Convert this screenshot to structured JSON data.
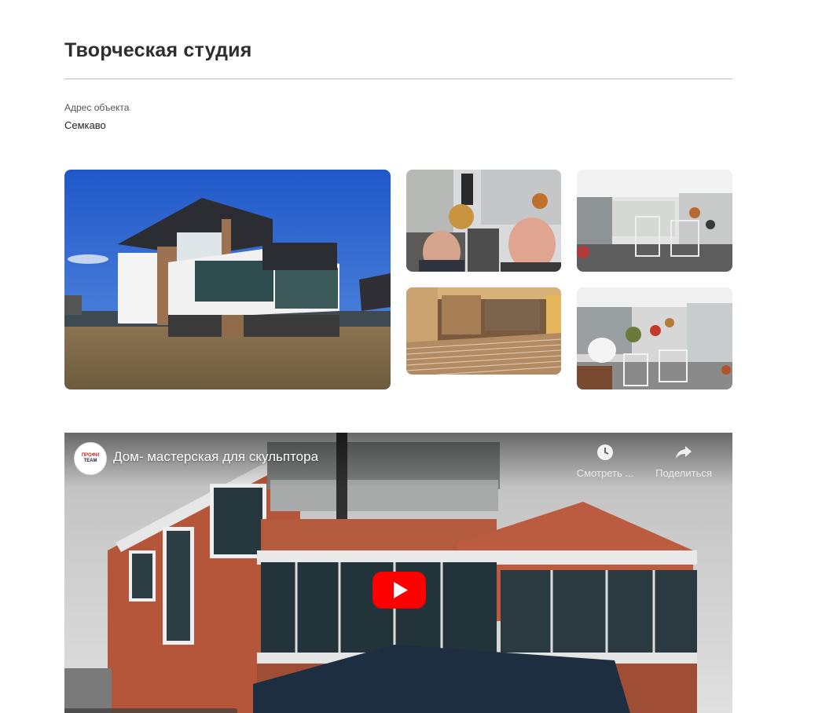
{
  "page": {
    "title": "Творческая студия",
    "address_label": "Адрес объекта",
    "address_value": "Семкаво"
  },
  "gallery": {
    "photos": [
      {
        "name": "exterior-house-photo"
      },
      {
        "name": "studio-selfie-photo"
      },
      {
        "name": "gallery-hall-photo"
      },
      {
        "name": "underfloor-heating-photo"
      },
      {
        "name": "sculpture-exhibit-photo"
      }
    ]
  },
  "video": {
    "channel_logo_line1": "ПРОФИ",
    "channel_logo_line2": "ТЕАМ",
    "title": "Дом- мастерская для скульптора",
    "watch_later_label": "Смотреть ...",
    "share_label": "Поделиться",
    "play_color": "#ff0000"
  }
}
